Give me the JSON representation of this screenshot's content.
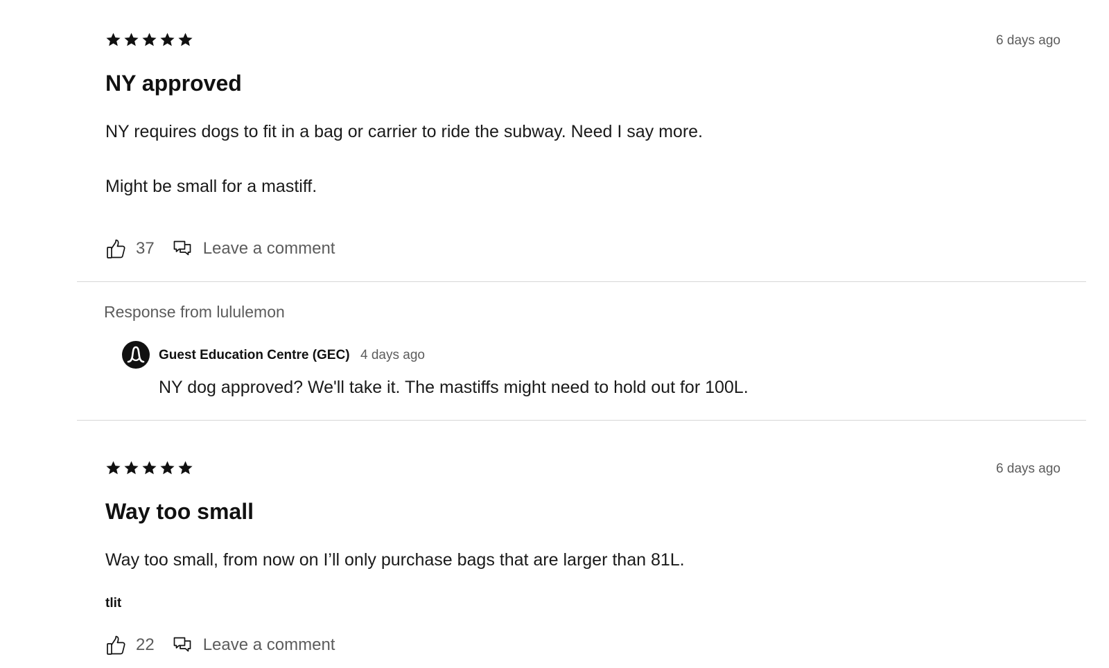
{
  "reviews": [
    {
      "rating": 5,
      "rating_max": 5,
      "date": "6 days ago",
      "title": "NY approved",
      "paragraphs": [
        "NY requires dogs to fit in a bag or carrier to ride the subway. Need I say more.",
        "Might be small for a mastiff."
      ],
      "likes": "37",
      "comment_label": "Leave a comment"
    },
    {
      "rating": 5,
      "rating_max": 5,
      "date": "6 days ago",
      "title": "Way too small",
      "paragraphs": [
        "Way too small, from now on I’ll only purchase bags that are larger than 81L."
      ],
      "author": "tlit",
      "likes": "22",
      "comment_label": "Leave a comment"
    }
  ],
  "response": {
    "header": "Response from lululemon",
    "responder": "Guest Education Centre (GEC)",
    "date": "4 days ago",
    "text": "NY dog approved? We'll take it. The mastiffs might need to hold out for 100L."
  },
  "icons": {
    "star": "star-icon",
    "like": "thumbs-up-icon",
    "comment": "comment-bubbles-icon",
    "logo": "lululemon-logo-icon"
  },
  "colors": {
    "text": "#111111",
    "muted": "#5c5c5c",
    "divider": "#d6d6d6"
  }
}
